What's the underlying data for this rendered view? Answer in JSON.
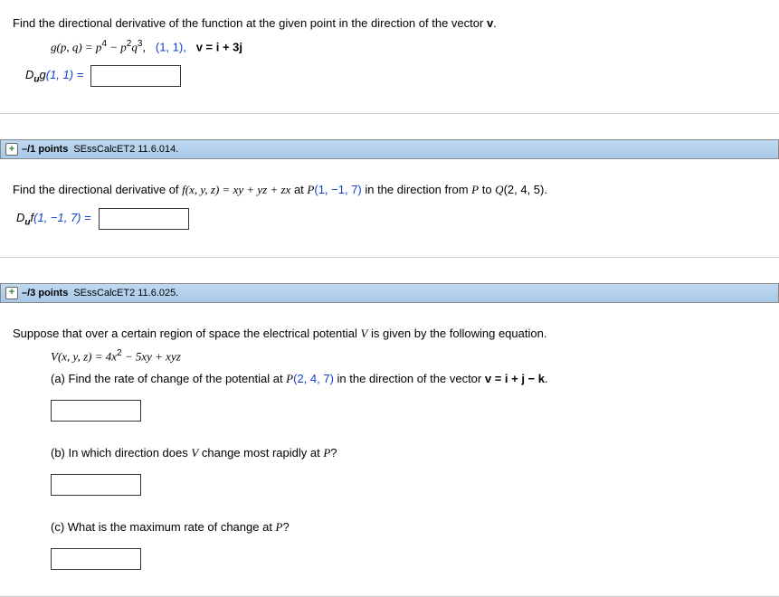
{
  "q1": {
    "prompt": "Find the directional derivative of the function at the given point in the direction of the vector ",
    "vec": "v",
    "period": ".",
    "func_lhs": "g(p, q) = p",
    "exp4": "4",
    "minus": " − p",
    "exp2": "2",
    "q_part": "q",
    "exp3": "3",
    "comma": ",",
    "point": "(1, 1),",
    "vec_eq": "v = i + 3j",
    "answer_label_pre": "D",
    "answer_label_sub": "u",
    "answer_label_mid": "g",
    "answer_label_arg": "(1, 1) = "
  },
  "q2": {
    "points": "–/1 points",
    "ref": "SEssCalcET2 11.6.014.",
    "prompt_a": "Find the directional derivative of ",
    "func": "f(x, y, z) = xy + yz + zx",
    "prompt_b": " at ",
    "P": "P",
    "Parg": "(1, −1, 7)",
    "prompt_c": " in the direction from ",
    "P2": "P",
    "to": " to ",
    "Q": "Q",
    "Qarg": "(2, 4, 5).",
    "answer_label_pre": "D",
    "answer_label_sub": "u",
    "answer_label_mid": "f",
    "answer_label_arg": "(1, −1, 7) = "
  },
  "q3": {
    "points": "–/3 points",
    "ref": "SEssCalcET2 11.6.025.",
    "intro_a": "Suppose that over a certain region of space the electrical potential ",
    "V": "V",
    "intro_b": " is given by the following equation.",
    "func_lhs": "V(x, y, z) = 4x",
    "exp2": "2",
    "func_rest": " − 5xy + xyz",
    "part_a_pre": "(a) Find the rate of change of the potential at ",
    "P": "P",
    "Parg": "(2, 4, 7)",
    "part_a_mid": " in the direction of the vector ",
    "vec_eq": "v = i + j − k",
    "part_a_end": ".",
    "part_b": "(b) In which direction does ",
    "V2": "V",
    "part_b_end": " change most rapidly at ",
    "P2": "P",
    "qmark": "?",
    "part_c": "(c) What is the maximum rate of change at ",
    "P3": "P",
    "qmark2": "?"
  }
}
